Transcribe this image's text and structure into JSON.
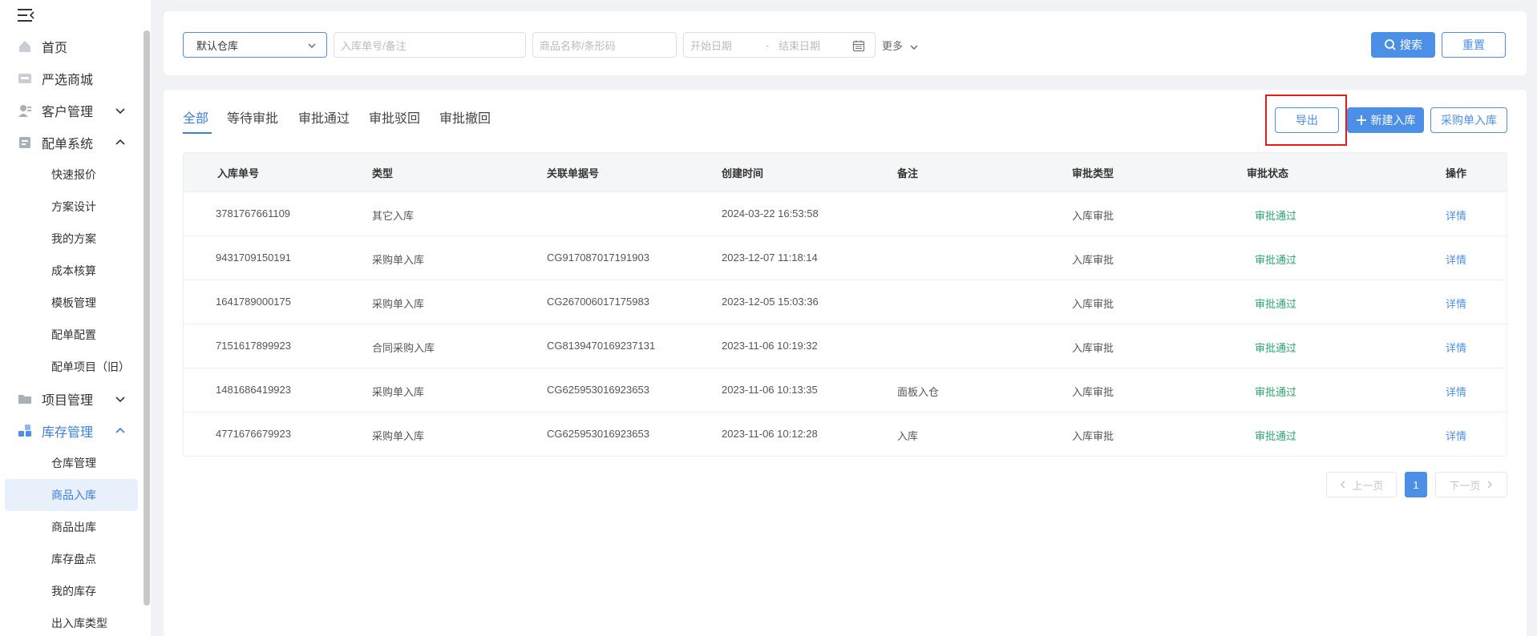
{
  "sidebar": {
    "items": [
      {
        "label": "首页",
        "icon": "home-icon"
      },
      {
        "label": "严选商城",
        "icon": "mall-icon"
      },
      {
        "label": "客户管理",
        "icon": "customer-icon"
      },
      {
        "label": "配单系统",
        "icon": "order-system-icon"
      },
      {
        "label": "项目管理",
        "icon": "folder-icon"
      },
      {
        "label": "库存管理",
        "icon": "inventory-icon"
      }
    ],
    "order_system_sub": [
      "快速报价",
      "方案设计",
      "我的方案",
      "成本核算",
      "模板管理",
      "配单配置",
      "配单项目（旧）"
    ],
    "inventory_sub": [
      "仓库管理",
      "商品入库",
      "商品出库",
      "库存盘点",
      "我的库存",
      "出入库类型"
    ]
  },
  "filters": {
    "warehouse_value": "默认仓库",
    "order_placeholder": "入库单号/备注",
    "product_placeholder": "商品名称/条形码",
    "start_date_placeholder": "开始日期",
    "date_separator": "-",
    "end_date_placeholder": "结束日期",
    "more_label": "更多",
    "search_label": "搜索",
    "reset_label": "重置"
  },
  "tabs": [
    "全部",
    "等待审批",
    "审批通过",
    "审批驳回",
    "审批撤回"
  ],
  "actions": {
    "export_label": "导出",
    "new_label": "新建入库",
    "purchase_label": "采购单入库"
  },
  "table": {
    "headers": [
      "入库单号",
      "类型",
      "关联单据号",
      "创建时间",
      "备注",
      "审批类型",
      "审批状态",
      "操作"
    ],
    "rows": [
      [
        "3781767661109",
        "其它入库",
        "",
        "2024-03-22 16:53:58",
        "",
        "入库审批",
        "审批通过",
        "详情"
      ],
      [
        "9431709150191",
        "采购单入库",
        "CG917087017191903",
        "2023-12-07 11:18:14",
        "",
        "入库审批",
        "审批通过",
        "详情"
      ],
      [
        "1641789000175",
        "采购单入库",
        "CG267006017175983",
        "2023-12-05 15:03:36",
        "",
        "入库审批",
        "审批通过",
        "详情"
      ],
      [
        "7151617899923",
        "合同采购入库",
        "CG8139470169237131",
        "2023-11-06 10:19:32",
        "",
        "入库审批",
        "审批通过",
        "详情"
      ],
      [
        "1481686419923",
        "采购单入库",
        "CG625953016923653",
        "2023-11-06 10:13:35",
        "面板入仓",
        "入库审批",
        "审批通过",
        "详情"
      ],
      [
        "4771676679923",
        "采购单入库",
        "CG625953016923653",
        "2023-11-06 10:12:28",
        "入库",
        "入库审批",
        "审批通过",
        "详情"
      ]
    ]
  },
  "pagination": {
    "prev_label": "上一页",
    "current_page": "1",
    "next_label": "下一页"
  },
  "colors": {
    "accent": "#4b8fe6",
    "success": "#2aa66e",
    "highlight": "#e8191b"
  }
}
